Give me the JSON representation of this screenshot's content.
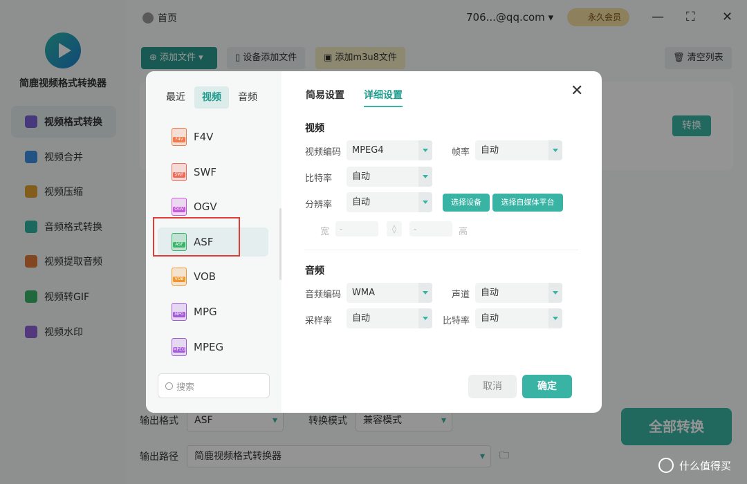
{
  "app": {
    "name": "简鹿视频格式转换器",
    "nav": [
      {
        "label": "视频格式转换",
        "active": true,
        "color": "#7b61d6"
      },
      {
        "label": "视频合并",
        "active": false,
        "color": "#3d8fe0"
      },
      {
        "label": "视频压缩",
        "active": false,
        "color": "#e0a030"
      },
      {
        "label": "音频格式转换",
        "active": false,
        "color": "#2fb3a2"
      },
      {
        "label": "视频提取音频",
        "active": false,
        "color": "#e07a3a"
      },
      {
        "label": "视频转GIF",
        "active": false,
        "color": "#3ab56a"
      },
      {
        "label": "视频水印",
        "active": false,
        "color": "#8d63d6"
      }
    ]
  },
  "topbar": {
    "home_label": "首页",
    "account": "706...@qq.com",
    "vip_label": "永久会员"
  },
  "toolbar": {
    "add_file": "添加文件",
    "device_add": "设备添加文件",
    "add_m3u8": "添加m3u8文件",
    "clear_list": "清空列表"
  },
  "file_card": {
    "convert_label": "转换"
  },
  "bottom": {
    "output_format_label": "输出格式",
    "output_format_value": "ASF",
    "convert_mode_label": "转换模式",
    "convert_mode_value": "兼容模式",
    "output_path_label": "输出路径",
    "output_path_value": "简鹿视频格式转换器",
    "convert_all": "全部转换"
  },
  "modal": {
    "category_tabs": [
      {
        "label": "最近",
        "active": false
      },
      {
        "label": "视频",
        "active": true
      },
      {
        "label": "音频",
        "active": false
      }
    ],
    "formats": [
      {
        "name": "F4V",
        "color": "#f07a4a",
        "selected": false
      },
      {
        "name": "SWF",
        "color": "#f06a5a",
        "selected": false
      },
      {
        "name": "OGV",
        "color": "#c45ad8",
        "selected": false
      },
      {
        "name": "ASF",
        "color": "#3ab56a",
        "selected": true
      },
      {
        "name": "VOB",
        "color": "#f0962e",
        "selected": false
      },
      {
        "name": "MPG",
        "color": "#a35ad8",
        "selected": false
      },
      {
        "name": "MPEG",
        "color": "#a35ad8",
        "selected": false
      }
    ],
    "search_placeholder": "搜索",
    "settings_tabs": [
      {
        "label": "简易设置",
        "active": false
      },
      {
        "label": "详细设置",
        "active": true
      }
    ],
    "video_section": "视频",
    "video_codec_label": "视频编码",
    "video_codec_value": "MPEG4",
    "frame_rate_label": "帧率",
    "frame_rate_value": "自动",
    "bitrate_label": "比特率",
    "bitrate_value": "自动",
    "resolution_label": "分辨率",
    "resolution_value": "自动",
    "select_device": "选择设备",
    "select_platform": "选择自媒体平台",
    "width_label": "宽",
    "width_value": "-",
    "height_label": "高",
    "height_value": "-",
    "audio_section": "音频",
    "audio_codec_label": "音频编码",
    "audio_codec_value": "WMA",
    "channel_label": "声道",
    "channel_value": "自动",
    "sample_rate_label": "采样率",
    "sample_rate_value": "自动",
    "audio_bitrate_label": "比特率",
    "audio_bitrate_value": "自动",
    "cancel": "取消",
    "confirm": "确定"
  },
  "watermark": "什么值得买",
  "colors": {
    "accent": "#39b3a4",
    "highlight": "#e53935"
  }
}
